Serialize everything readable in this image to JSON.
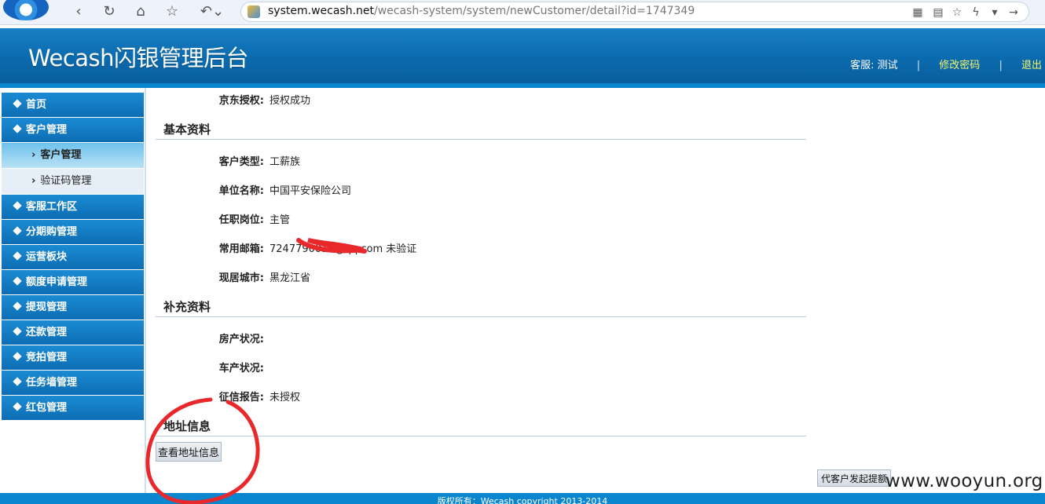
{
  "browser": {
    "url_domain": "system.wecash.net",
    "url_path": "/wecash-system/system/newCustomer/detail?id=1747349"
  },
  "header": {
    "title": "Wecash闪银管理后台",
    "user_label": "客服: 测试",
    "separator": "|",
    "change_password": "修改密码",
    "logout": "退出"
  },
  "sidebar": {
    "items": [
      {
        "label": "首页"
      },
      {
        "label": "客户管理"
      },
      {
        "label": "客户管理"
      },
      {
        "label": "验证码管理"
      },
      {
        "label": "客服工作区"
      },
      {
        "label": "分期购管理"
      },
      {
        "label": "运营板块"
      },
      {
        "label": "额度申请管理"
      },
      {
        "label": "提现管理"
      },
      {
        "label": "还款管理"
      },
      {
        "label": "竞拍管理"
      },
      {
        "label": "任务墙管理"
      },
      {
        "label": "红包管理"
      }
    ],
    "sub_chevron": "›"
  },
  "main": {
    "jd_auth": {
      "label": "京东授权:",
      "value": "授权成功"
    },
    "basic_section": "基本资料",
    "customer_type": {
      "label": "客户类型:",
      "value": "工薪族"
    },
    "company": {
      "label": "单位名称:",
      "value": "中国平安保险公司"
    },
    "position": {
      "label": "任职岗位:",
      "value": "主管"
    },
    "email": {
      "label": "常用邮箱:",
      "value": "7247790010@qq.com",
      "status": "未验证"
    },
    "city": {
      "label": "现居城市:",
      "value": "黑龙江省"
    },
    "extra_section": "补充资料",
    "house": {
      "label": "房产状况:",
      "value": ""
    },
    "car": {
      "label": "车产状况:",
      "value": ""
    },
    "credit": {
      "label": "征信报告:",
      "value": "未授权"
    },
    "address_section": "地址信息",
    "view_address_button": "查看地址信息",
    "withdraw_button": "代客户发起提额"
  },
  "watermark": "www.wooyun.org",
  "footer": "版权所有：Wecash copyright 2013-2014",
  "colors": {
    "header_blue": "#0b6aae",
    "menu_blue": "#1b8bd4",
    "link_yellow": "#f5f56a",
    "annotation_red": "#e8282b"
  }
}
